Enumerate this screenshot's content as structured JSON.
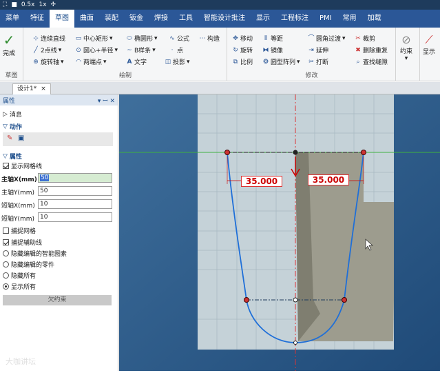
{
  "titlebar": {
    "zoom_label": "0.5x",
    "speed_label": "1x"
  },
  "menubar": {
    "items": [
      "菜单",
      "特征",
      "草图",
      "曲面",
      "装配",
      "钣金",
      "焊接",
      "工具",
      "智能设计批注",
      "显示",
      "工程标注",
      "PMI",
      "常用",
      "加载"
    ],
    "active": "草图"
  },
  "ribbon": {
    "complete_label": "完成",
    "group_sketch_label": "草图",
    "draw": {
      "label": "绘制",
      "row1": [
        "连续直线",
        "中心矩形",
        "椭圆形",
        "公式",
        "构造"
      ],
      "row2": [
        "2点线",
        "圆心+半径",
        "B样条",
        "点"
      ],
      "row3": [
        "旋转轴",
        "两端点",
        "文字",
        "投影"
      ]
    },
    "modify": {
      "label": "修改",
      "col1": [
        "移动",
        "旋转",
        "比例"
      ],
      "col2": [
        "等距",
        "镜像",
        "圆型阵列"
      ],
      "col3": [
        "圆角过渡",
        "延伸",
        "打断"
      ],
      "col4": [
        "裁剪",
        "删除重复",
        "查找缝隙"
      ]
    },
    "constraint_label": "约束",
    "display_label": "显示"
  },
  "doc_tab": {
    "label": "设计1*",
    "close": "×"
  },
  "panel": {
    "title": "属性",
    "header_controls": "▾ ꟷ ✕",
    "sections": {
      "message": "消息",
      "action": "动作",
      "properties": "属性"
    },
    "show_grid": "显示网格线",
    "fields": [
      {
        "label": "主轴X(mm)",
        "value": "50"
      },
      {
        "label": "主轴Y(mm)",
        "value": "50"
      },
      {
        "label": "短轴X(mm)",
        "value": "10"
      },
      {
        "label": "短轴Y(mm)",
        "value": "10"
      }
    ],
    "checkboxes": [
      {
        "label": "捕捉网格",
        "checked": false
      },
      {
        "label": "捕捉辅助线",
        "checked": true
      }
    ],
    "radios": [
      {
        "label": "隐藏编辑的智能图素",
        "checked": false
      },
      {
        "label": "隐藏编辑的零件",
        "checked": false
      },
      {
        "label": "隐藏所有",
        "checked": false
      },
      {
        "label": "显示所有",
        "checked": true
      }
    ],
    "constrain_button": "欠约束"
  },
  "canvas": {
    "dimension_left": "35.000",
    "dimension_right": "35.000"
  },
  "watermark": "大咖讲坛"
}
